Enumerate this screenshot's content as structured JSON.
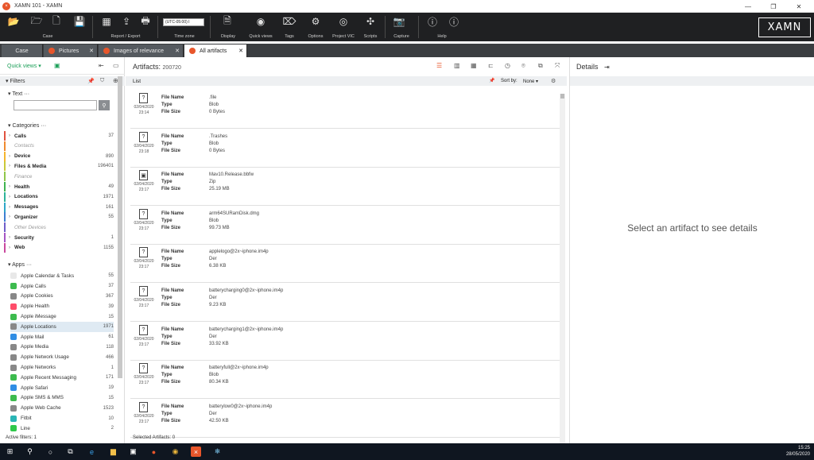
{
  "window": {
    "title": "XAMN 101 - XAMN"
  },
  "ribbon": {
    "groups": [
      {
        "label": "Case"
      },
      {
        "label": "Report / Export"
      },
      {
        "label": "Time zone"
      },
      {
        "label": "Display"
      },
      {
        "label": "Quick views"
      },
      {
        "label": "Tags"
      },
      {
        "label": "Options"
      },
      {
        "label": "Project VIC"
      },
      {
        "label": "Scripts"
      },
      {
        "label": "Capture"
      },
      {
        "label": "Help"
      }
    ],
    "timezone_value": "(UTC-05:00) I",
    "logo": "XAMN"
  },
  "tabs": [
    {
      "label": "Case"
    },
    {
      "label": "Pictures"
    },
    {
      "label": "Images of relevance"
    },
    {
      "label": "All artifacts"
    }
  ],
  "left": {
    "quick_views": "Quick views",
    "filters": "Filters",
    "text_section": "Text",
    "categories_section": "Categories",
    "categories": [
      {
        "label": "Calls",
        "count": "37",
        "color": "#e0523f"
      },
      {
        "label": "Contacts",
        "count": "",
        "color": "#f08a30",
        "dim": true
      },
      {
        "label": "Device",
        "count": "890",
        "color": "#f5b52e"
      },
      {
        "label": "Files & Media",
        "count": "196401",
        "color": "#c9c93a"
      },
      {
        "label": "Finance",
        "count": "",
        "color": "#8fc64a",
        "dim": true
      },
      {
        "label": "Health",
        "count": "49",
        "color": "#3fb34f"
      },
      {
        "label": "Locations",
        "count": "1971",
        "color": "#2eb39a"
      },
      {
        "label": "Messages",
        "count": "161",
        "color": "#2ea6c9"
      },
      {
        "label": "Organizer",
        "count": "55",
        "color": "#3d7fd1"
      },
      {
        "label": "Other Devices",
        "count": "",
        "color": "#6f5fc9",
        "dim": true
      },
      {
        "label": "Security",
        "count": "1",
        "color": "#a455c4"
      },
      {
        "label": "Web",
        "count": "1155",
        "color": "#c9499e"
      }
    ],
    "apps_section": "Apps",
    "apps": [
      {
        "label": "Apple Calendar & Tasks",
        "count": "55",
        "color": "#e8e8e8"
      },
      {
        "label": "Apple Calls",
        "count": "37",
        "color": "#3dbb4e"
      },
      {
        "label": "Apple Cookies",
        "count": "367",
        "color": "#888888"
      },
      {
        "label": "Apple Health",
        "count": "39",
        "color": "#ff4d6a"
      },
      {
        "label": "Apple iMessage",
        "count": "15",
        "color": "#3dbb4e"
      },
      {
        "label": "Apple Locations",
        "count": "1971",
        "color": "#888888"
      },
      {
        "label": "Apple Mail",
        "count": "61",
        "color": "#2f8de4"
      },
      {
        "label": "Apple Media",
        "count": "118",
        "color": "#888888"
      },
      {
        "label": "Apple Network Usage",
        "count": "466",
        "color": "#888888"
      },
      {
        "label": "Apple Networks",
        "count": "1",
        "color": "#888888"
      },
      {
        "label": "Apple Recent Messaging",
        "count": "171",
        "color": "#3dbb4e"
      },
      {
        "label": "Apple Safari",
        "count": "19",
        "color": "#2f8de4"
      },
      {
        "label": "Apple SMS & MMS",
        "count": "15",
        "color": "#3dbb4e"
      },
      {
        "label": "Apple Web Cache",
        "count": "1523",
        "color": "#888888"
      },
      {
        "label": "Fitbit",
        "count": "10",
        "color": "#2ab5b5"
      },
      {
        "label": "Line",
        "count": "2",
        "color": "#2ec84a"
      }
    ],
    "active_filters": "Active filters: 1"
  },
  "middle": {
    "artifacts_label": "Artifacts:",
    "artifacts_count": "200720",
    "list_label": "List",
    "sort_label": "Sort by:",
    "sort_value": "None",
    "field_labels": [
      "File Name",
      "Type",
      "File Size"
    ],
    "rows": [
      {
        "date": "02/04/2020",
        "time": "23:14",
        "name": ".file",
        "type": "Blob",
        "size": "0 Bytes",
        "icon": "?"
      },
      {
        "date": "02/04/2020",
        "time": "23:18",
        "name": ".Trashes",
        "type": "Blob",
        "size": "0 Bytes",
        "icon": "?"
      },
      {
        "date": "02/04/2020",
        "time": "23:17",
        "name": "Mav10.Release.bbfw",
        "type": "Zip",
        "size": "25.19 MB",
        "icon": "▣"
      },
      {
        "date": "02/04/2020",
        "time": "23:17",
        "name": "arm64SURamDisk.dmg",
        "type": "Blob",
        "size": "99.73 MB",
        "icon": "?"
      },
      {
        "date": "02/04/2020",
        "time": "23:17",
        "name": "applelogo@2x~iphone.im4p",
        "type": "Der",
        "size": "6.38 KB",
        "icon": "?"
      },
      {
        "date": "02/04/2020",
        "time": "23:17",
        "name": "batterycharging0@2x~iphone.im4p",
        "type": "Der",
        "size": "9.23 KB",
        "icon": "?"
      },
      {
        "date": "02/04/2020",
        "time": "23:17",
        "name": "batterycharging1@2x~iphone.im4p",
        "type": "Der",
        "size": "33.92 KB",
        "icon": "?"
      },
      {
        "date": "02/04/2020",
        "time": "23:17",
        "name": "batteryfull@2x~iphone.im4p",
        "type": "Blob",
        "size": "80.34 KB",
        "icon": "?"
      },
      {
        "date": "02/04/2020",
        "time": "23:17",
        "name": "batterylow0@2x~iphone.im4p",
        "type": "Der",
        "size": "42.50 KB",
        "icon": "?"
      }
    ],
    "selected_artifacts": "Selected Artifacts: 0"
  },
  "right": {
    "details_title": "Details",
    "empty_message": "Select an artifact to see details"
  },
  "taskbar": {
    "time": "15:25",
    "date": "28/05/2020"
  }
}
